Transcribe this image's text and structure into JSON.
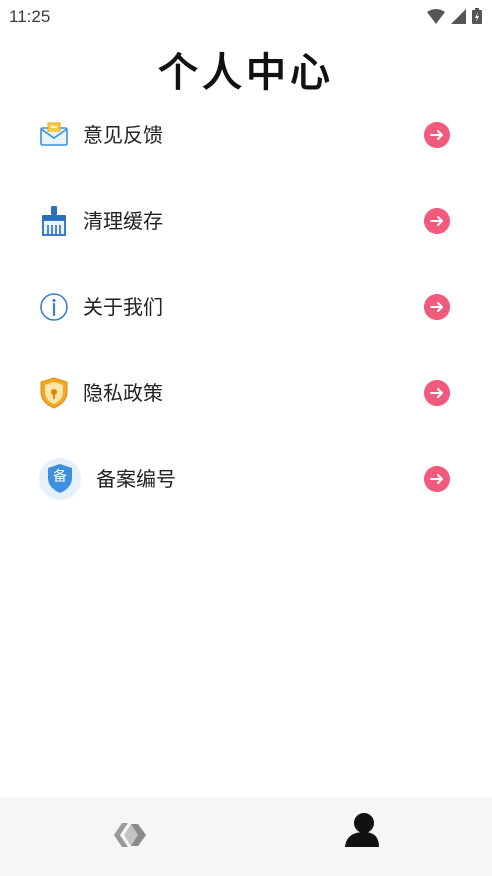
{
  "status_bar": {
    "time": "11:25"
  },
  "header": {
    "title": "个人中心"
  },
  "menu": {
    "items": [
      {
        "label": "意见反馈",
        "icon": "envelope-icon"
      },
      {
        "label": "清理缓存",
        "icon": "broom-icon"
      },
      {
        "label": "关于我们",
        "icon": "info-icon"
      },
      {
        "label": "隐私政策",
        "icon": "shield-lock-icon"
      },
      {
        "label": "备案编号",
        "icon": "record-shield-icon",
        "badge": "备"
      }
    ],
    "arrow_color": "#f15a7a"
  },
  "bottom_nav": {
    "tabs": [
      {
        "icon": "app-logo-icon",
        "active": false
      },
      {
        "icon": "user-icon",
        "active": true
      }
    ]
  }
}
